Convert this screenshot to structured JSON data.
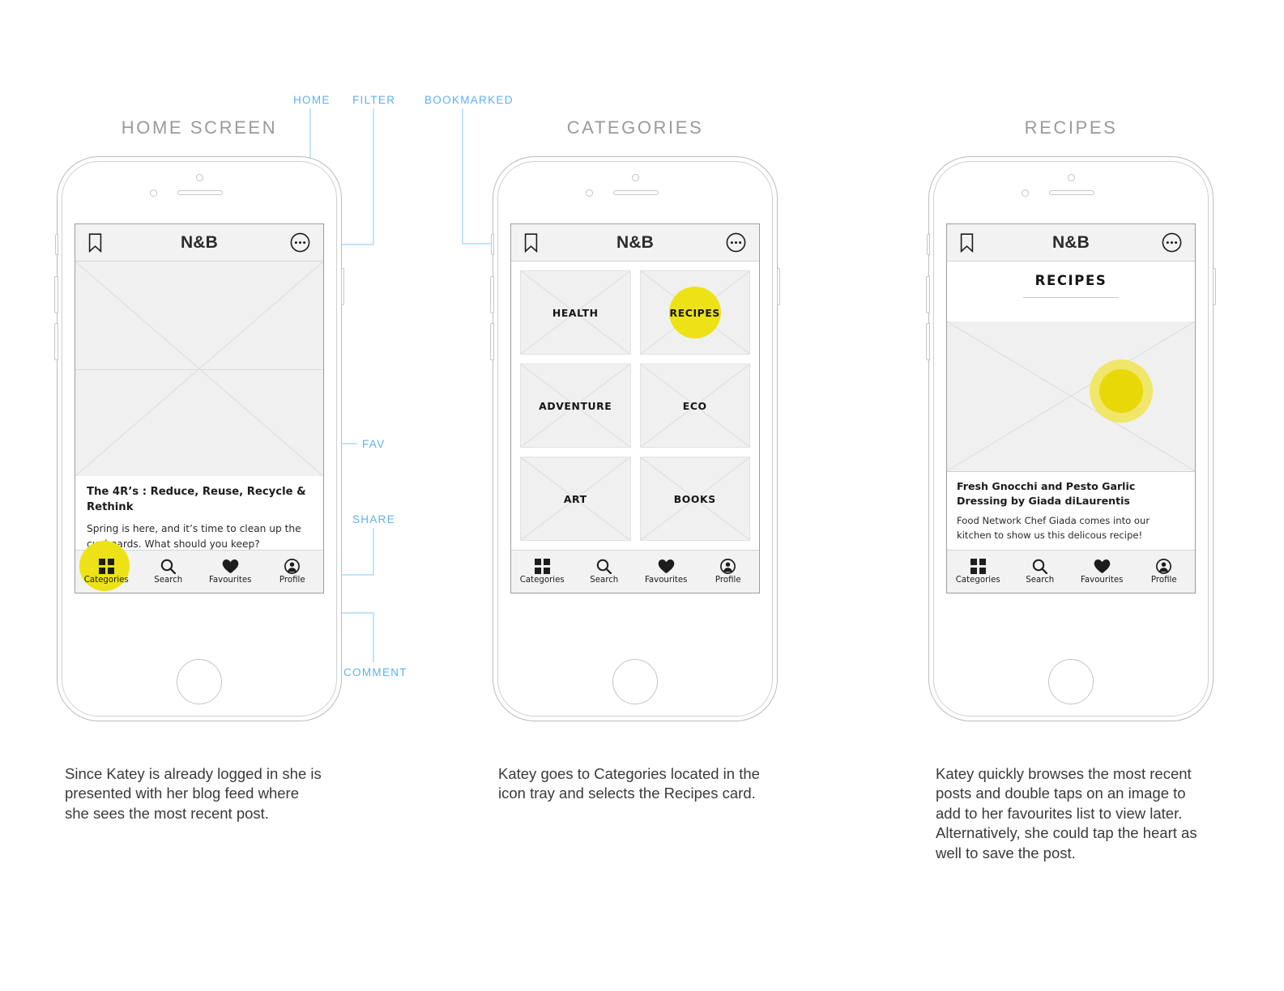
{
  "meta": {
    "accent_yellow": "#EDE215",
    "callout_blue": "#5BB1F2",
    "title_gray": "#9a9a9a",
    "screen_bg": "#ffffff",
    "chrome_gray": "#f2f2f2"
  },
  "callouts": [
    {
      "label": "HOME"
    },
    {
      "label": "FILTER"
    },
    {
      "label": "BOOKMARKED"
    },
    {
      "label": "FAV"
    },
    {
      "label": "SHARE"
    },
    {
      "label": "COMMENT"
    }
  ],
  "screens": [
    {
      "title": "HOME SCREEN",
      "navbar": {
        "brand": "N&B",
        "left_icon": "bookmark-icon",
        "right_icon": "more-dots-icon"
      },
      "post": {
        "title": "The 4R’s : Reduce, Reuse, Recycle & Rethink",
        "body": "Spring is here, and it’s time to clean up the cupboards. What should you keep?",
        "actions": [
          {
            "name": "fav-heart-icon"
          },
          {
            "name": "comment-bubble-icon"
          },
          {
            "name": "share-arrow-icon"
          }
        ]
      },
      "tabs": [
        {
          "label": "Categories",
          "icon": "grid-icon",
          "active": true
        },
        {
          "label": "Search",
          "icon": "search-icon",
          "active": false
        },
        {
          "label": "Favourites",
          "icon": "heart-icon",
          "active": false
        },
        {
          "label": "Profile",
          "icon": "profile-icon",
          "active": false
        }
      ],
      "caption": "Since Katey is already logged in she is presented with her blog feed where she sees the most recent post."
    },
    {
      "title": "CATEGORIES",
      "navbar": {
        "brand": "N&B",
        "left_icon": "bookmark-icon",
        "right_icon": "more-dots-icon"
      },
      "categories": [
        {
          "label": "HEALTH",
          "selected": false
        },
        {
          "label": "RECIPES",
          "selected": true
        },
        {
          "label": "ADVENTURE",
          "selected": false
        },
        {
          "label": "ECO",
          "selected": false
        },
        {
          "label": "ART",
          "selected": false
        },
        {
          "label": "BOOKS",
          "selected": false
        }
      ],
      "tabs": [
        {
          "label": "Categories",
          "icon": "grid-icon",
          "active": false
        },
        {
          "label": "Search",
          "icon": "search-icon",
          "active": false
        },
        {
          "label": "Favourites",
          "icon": "heart-icon",
          "active": false
        },
        {
          "label": "Profile",
          "icon": "profile-icon",
          "active": false
        }
      ],
      "caption": "Katey goes to Categories located in the icon tray and selects the Recipes card."
    },
    {
      "title": "RECIPES",
      "navbar": {
        "brand": "N&B",
        "left_icon": "bookmark-icon",
        "right_icon": "more-dots-icon"
      },
      "page_heading": "RECIPES",
      "post": {
        "title": "Fresh Gnocchi and Pesto Garlic Dressing by Giada diLaurentis",
        "body": "Food Network Chef Giada comes into our kitchen to show us this delicous recipe!"
      },
      "tabs": [
        {
          "label": "Categories",
          "icon": "grid-icon",
          "active": false
        },
        {
          "label": "Search",
          "icon": "search-icon",
          "active": false
        },
        {
          "label": "Favourites",
          "icon": "heart-icon",
          "active": false
        },
        {
          "label": "Profile",
          "icon": "profile-icon",
          "active": false
        }
      ],
      "caption": "Katey quickly browses the most recent posts and double taps on an image to add to her favourites list to view later. Alternatively, she could tap the heart as well to save the post."
    }
  ]
}
